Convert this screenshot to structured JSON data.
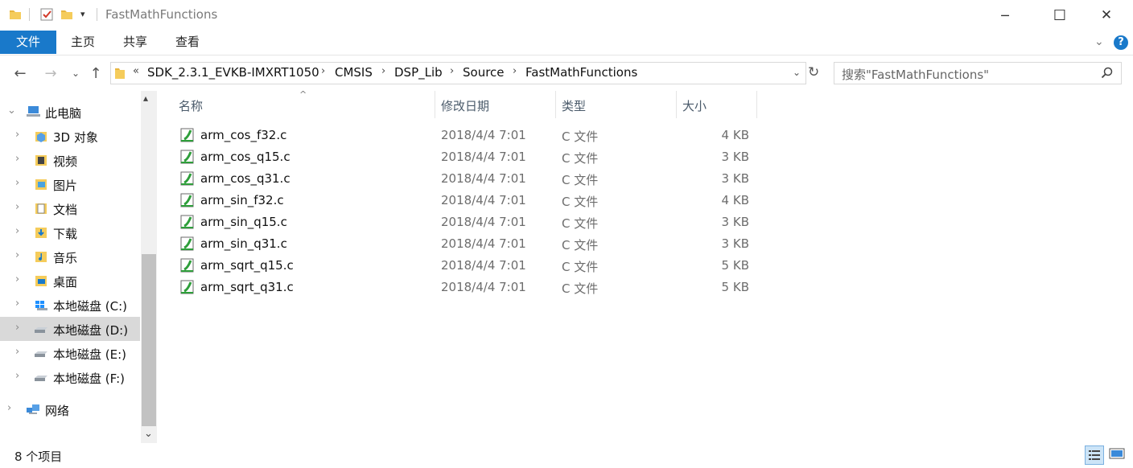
{
  "window": {
    "title": "FastMathFunctions",
    "minimize_glyph": "─",
    "maximize_glyph": "☐",
    "close_glyph": "✕"
  },
  "ribbon": {
    "tabs": [
      "文件",
      "主页",
      "共享",
      "查看"
    ],
    "accent": "#1979ca"
  },
  "address": {
    "overflow": "«",
    "crumbs": [
      "SDK_2.3.1_EVKB-IMXRT1050",
      "CMSIS",
      "DSP_Lib",
      "Source",
      "FastMathFunctions"
    ]
  },
  "search": {
    "placeholder": "搜索\"FastMathFunctions\""
  },
  "nav": {
    "items": [
      {
        "label": "此电脑",
        "icon": "pc-icon"
      },
      {
        "label": "3D 对象",
        "icon": "3d-objects-icon"
      },
      {
        "label": "视频",
        "icon": "video-folder-icon"
      },
      {
        "label": "图片",
        "icon": "pictures-folder-icon"
      },
      {
        "label": "文档",
        "icon": "documents-folder-icon"
      },
      {
        "label": "下载",
        "icon": "downloads-folder-icon"
      },
      {
        "label": "音乐",
        "icon": "music-folder-icon"
      },
      {
        "label": "桌面",
        "icon": "desktop-folder-icon"
      },
      {
        "label": "本地磁盘 (C:)",
        "icon": "windows-drive-icon"
      },
      {
        "label": "本地磁盘 (D:)",
        "icon": "drive-icon"
      },
      {
        "label": "本地磁盘 (E:)",
        "icon": "drive-icon"
      },
      {
        "label": "本地磁盘 (F:)",
        "icon": "drive-icon"
      },
      {
        "label": "网络",
        "icon": "network-icon"
      }
    ]
  },
  "columns": {
    "name": "名称",
    "date": "修改日期",
    "type": "类型",
    "size": "大小"
  },
  "files": [
    {
      "name": "arm_cos_f32.c",
      "date": "2018/4/4 7:01",
      "type": "C 文件",
      "size": "4 KB"
    },
    {
      "name": "arm_cos_q15.c",
      "date": "2018/4/4 7:01",
      "type": "C 文件",
      "size": "3 KB"
    },
    {
      "name": "arm_cos_q31.c",
      "date": "2018/4/4 7:01",
      "type": "C 文件",
      "size": "3 KB"
    },
    {
      "name": "arm_sin_f32.c",
      "date": "2018/4/4 7:01",
      "type": "C 文件",
      "size": "4 KB"
    },
    {
      "name": "arm_sin_q15.c",
      "date": "2018/4/4 7:01",
      "type": "C 文件",
      "size": "3 KB"
    },
    {
      "name": "arm_sin_q31.c",
      "date": "2018/4/4 7:01",
      "type": "C 文件",
      "size": "3 KB"
    },
    {
      "name": "arm_sqrt_q15.c",
      "date": "2018/4/4 7:01",
      "type": "C 文件",
      "size": "5 KB"
    },
    {
      "name": "arm_sqrt_q31.c",
      "date": "2018/4/4 7:01",
      "type": "C 文件",
      "size": "5 KB"
    }
  ],
  "status": {
    "count": "8 个项目"
  }
}
